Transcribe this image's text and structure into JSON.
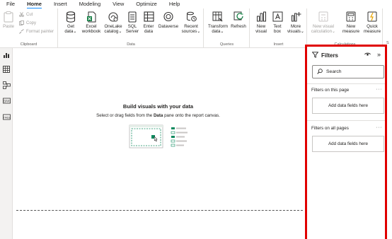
{
  "tabs": [
    {
      "label": "File"
    },
    {
      "label": "Home"
    },
    {
      "label": "Insert"
    },
    {
      "label": "Modeling"
    },
    {
      "label": "View"
    },
    {
      "label": "Optimize"
    },
    {
      "label": "Help"
    }
  ],
  "ribbon": {
    "clipboard": {
      "label": "Clipboard",
      "paste": "Paste",
      "cut": "Cut",
      "copy": "Copy",
      "format_painter": "Format painter"
    },
    "data": {
      "label": "Data",
      "get_data": [
        "Get",
        "data"
      ],
      "excel": [
        "Excel",
        "workbook"
      ],
      "onelake": [
        "OneLake",
        "catalog"
      ],
      "sql": [
        "SQL",
        "Server"
      ],
      "enter": [
        "Enter",
        "data"
      ],
      "dataverse": [
        "Dataverse",
        ""
      ],
      "recent": [
        "Recent",
        "sources"
      ]
    },
    "queries": {
      "label": "Queries",
      "transform": [
        "Transform",
        "data"
      ],
      "refresh": [
        "Refresh",
        ""
      ]
    },
    "insert": {
      "label": "Insert",
      "new_visual": [
        "New",
        "visual"
      ],
      "text_box": [
        "Text",
        "box"
      ],
      "more_visuals": [
        "More",
        "visuals"
      ]
    },
    "calculations": {
      "label": "Calculations",
      "new_visual_calc": [
        "New visual",
        "calculation"
      ],
      "new_measure": [
        "New",
        "measure"
      ],
      "quick_measure": [
        "Quick",
        "measure"
      ]
    },
    "cut_label": "S"
  },
  "canvas": {
    "title": "Build visuals with your data",
    "sub_pre": "Select or drag fields from the ",
    "sub_bold": "Data",
    "sub_post": " pane onto the report canvas."
  },
  "filters": {
    "title": "Filters",
    "search_placeholder": "Search",
    "on_this_page": "Filters on this page",
    "on_all_pages": "Filters on all pages",
    "add_fields": "Add data fields here",
    "more": "···",
    "collapse": "»"
  },
  "colors": {
    "accent": "#118dff",
    "highlight_border": "#e00000",
    "excel_green": "#107c41",
    "icon_gray": "#323130"
  }
}
